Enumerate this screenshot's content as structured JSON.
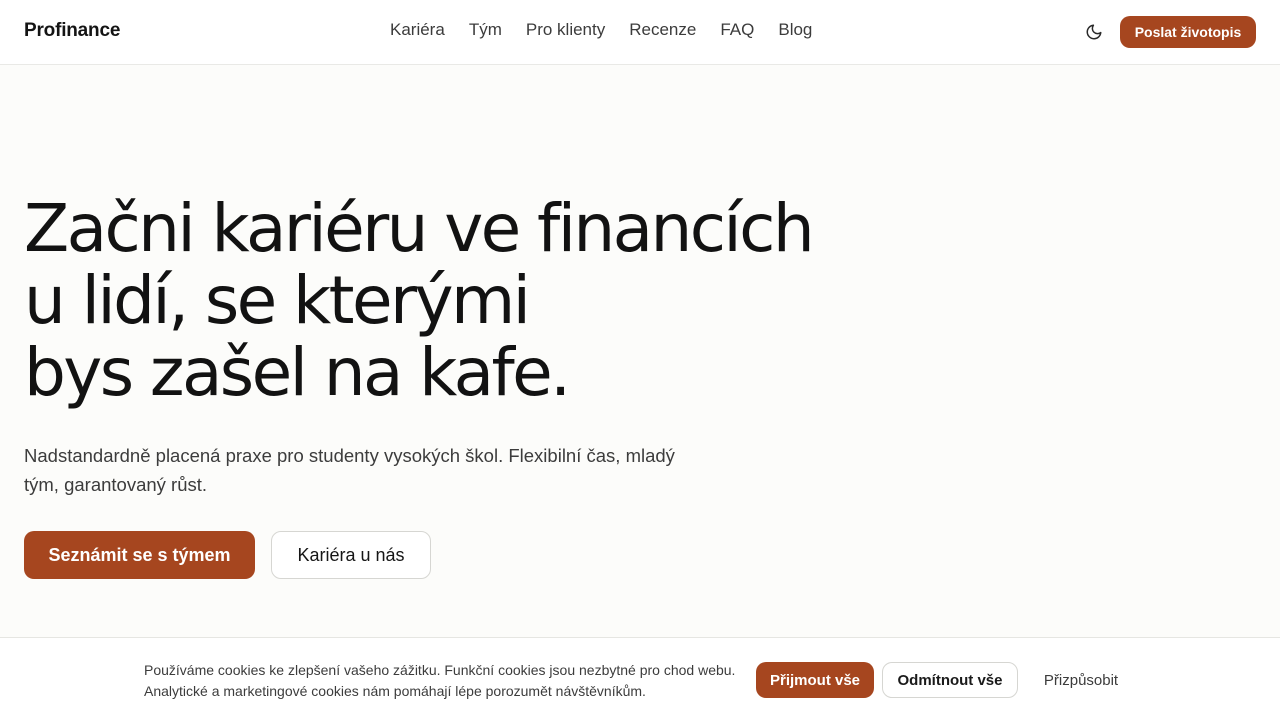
{
  "header": {
    "brand": "Profinance",
    "nav": [
      {
        "label": "Kariéra"
      },
      {
        "label": "Tým"
      },
      {
        "label": "Pro klienty"
      },
      {
        "label": "Recenze"
      },
      {
        "label": "FAQ"
      },
      {
        "label": "Blog"
      }
    ],
    "theme_toggle_icon": "moon-icon",
    "cta_label": "Poslat životopis"
  },
  "hero": {
    "title_lines": [
      "Začni kariéru ve financích",
      "u lidí, se kterými",
      "bys zašel na kafe."
    ],
    "subtitle": "Nadstandardně placená praxe pro studenty vysokých škol. Flexibilní čas, mladý tým, garantovaný růst.",
    "primary_button": "Seznámit se s týmem",
    "secondary_button": "Kariéra u nás"
  },
  "cookie_banner": {
    "text": "Používáme cookies ke zlepšení vašeho zážitku. Funkční cookies jsou nezbytné pro chod webu. Analytické a marketingové cookies nám pomáhají lépe porozumět návštěvníkům.",
    "accept_label": "Přijmout vše",
    "reject_label": "Odmítnout vše",
    "customize_label": "Přizpůsobit"
  },
  "colors": {
    "accent": "#a6461f",
    "background": "#fcfcfa",
    "text": "#161616"
  }
}
